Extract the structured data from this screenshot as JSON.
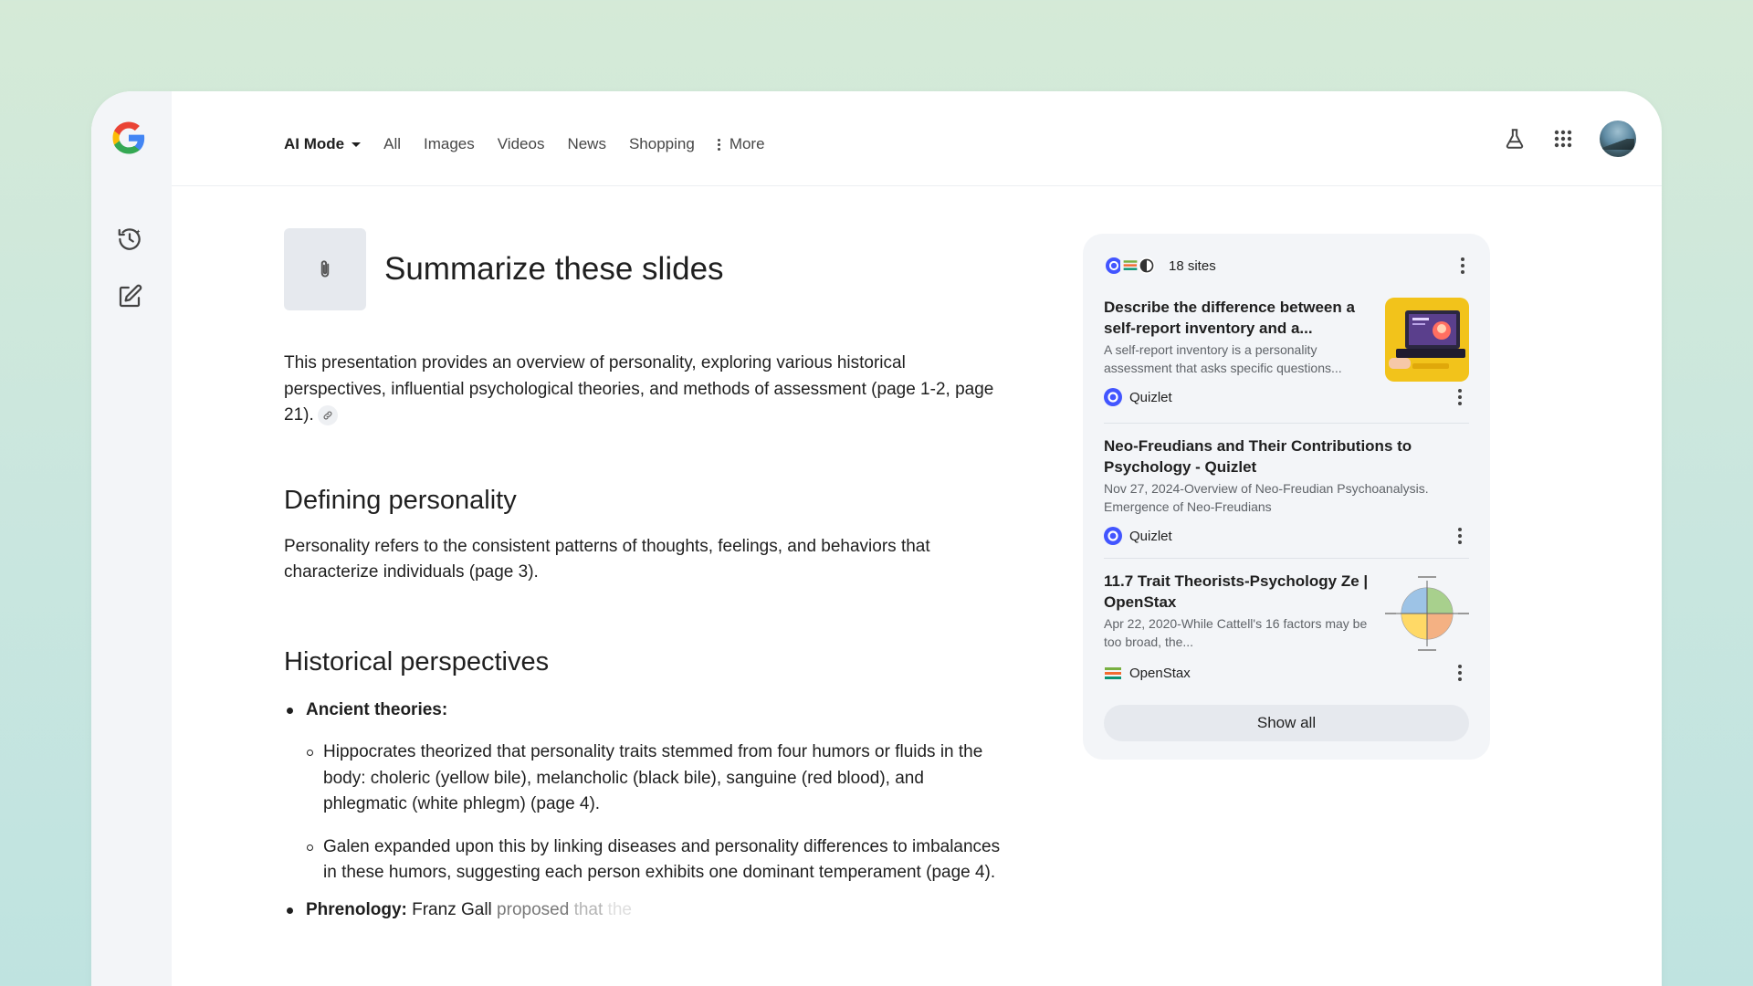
{
  "nav": {
    "tabs": [
      {
        "label": "AI Mode"
      },
      {
        "label": "All"
      },
      {
        "label": "Images"
      },
      {
        "label": "Videos"
      },
      {
        "label": "News"
      },
      {
        "label": "Shopping"
      },
      {
        "label": "More"
      }
    ]
  },
  "query": {
    "title": "Summarize these slides"
  },
  "content": {
    "intro": "This presentation provides an overview of personality, exploring various historical perspectives, influential psychological theories, and methods of assessment (page 1-2, page 21).",
    "h_defining": "Defining personality",
    "defining_text": "Personality refers to the consistent patterns of thoughts, feelings, and behaviors that characterize individuals (page 3).",
    "h_historical": "Historical perspectives",
    "ancient_label": "Ancient theories:",
    "hippocrates": "Hippocrates theorized that personality traits stemmed from four humors or fluids in the body: choleric (yellow bile), melancholic (black bile), sanguine (red blood), and phlegmatic (white phlegm) (page 4).",
    "galen": "Galen expanded upon this by linking diseases and personality differences to imbalances in these humors, suggesting each person exhibits one dominant temperament (page 4).",
    "phrenology_label": "Phrenology:",
    "phrenology_text_1": "Franz Gall",
    "phrenology_text_2": "proposed",
    "phrenology_text_3": "that",
    "phrenology_text_4": "the"
  },
  "sources": {
    "count_label": "18 sites",
    "items": [
      {
        "title": "Describe the difference between a self-report inventory and a...",
        "snippet": "A self-report inventory is a personality assessment that asks specific questions...",
        "site": "Quizlet"
      },
      {
        "title": "Neo-Freudians and Their Contributions to Psychology - Quizlet",
        "snippet": "Nov 27, 2024-Overview of Neo-Freudian Psychoanalysis. Emergence of Neo-Freudians",
        "site": "Quizlet"
      },
      {
        "title": "11.7 Trait Theorists-Psychology Ze | OpenStax",
        "snippet": "Apr 22, 2020-While Cattell's 16 factors may be too broad, the...",
        "site": "OpenStax"
      }
    ],
    "show_all": "Show all"
  },
  "colors": {
    "background": "#d0e8dc",
    "rail": "#f3f5f8",
    "panel": "#f3f5f8",
    "quizlet": "#4255ff"
  }
}
